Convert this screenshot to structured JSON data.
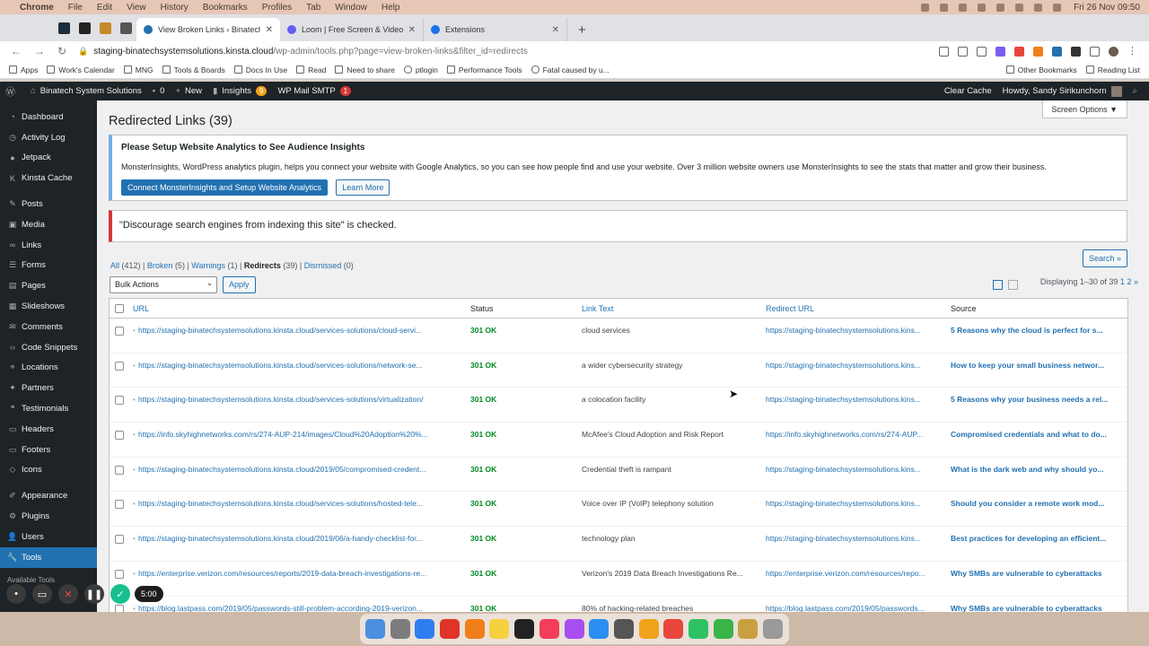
{
  "menubar": {
    "app": "Chrome",
    "items": [
      "File",
      "Edit",
      "View",
      "History",
      "Bookmarks",
      "Profiles",
      "Tab",
      "Window",
      "Help"
    ],
    "clock": "Fri 26 Nov  09:50"
  },
  "tabs": [
    {
      "title": "View Broken Links ‹ Binatech S",
      "active": true,
      "color": "#2271b1"
    },
    {
      "title": "Loom | Free Screen & Video Re",
      "active": false,
      "color": "#625df5"
    },
    {
      "title": "Extensions",
      "active": false,
      "color": "#1a73e8"
    }
  ],
  "toolbar": {
    "url_host": "staging-binatechsystemsolutions.kinsta.cloud",
    "url_path": "/wp-admin/tools.php?page=view-broken-links&filter_id=redirects"
  },
  "bookmarks": {
    "left": [
      "Apps",
      "Work's Calendar",
      "MNG",
      "Tools & Boards",
      "Docs In Use",
      "Read",
      "Need to share",
      "ptlogin",
      "Performance Tools",
      "Fatal caused by u..."
    ],
    "right": [
      "Other Bookmarks",
      "Reading List"
    ]
  },
  "adminbar": {
    "site": "Binatech System Solutions",
    "comments": "0",
    "new": "New",
    "insights": "Insights",
    "insights_badge": "9",
    "smtp": "WP Mail SMTP",
    "smtp_badge": "1",
    "clear_cache": "Clear Cache",
    "howdy": "Howdy, Sandy Sirikunchorn"
  },
  "sidebar": {
    "groups": [
      [
        {
          "label": "Dashboard",
          "icon": "dashboard-icon",
          "glyph": "◔"
        },
        {
          "label": "Activity Log",
          "icon": "activity-icon",
          "glyph": "◷"
        },
        {
          "label": "Jetpack",
          "icon": "jetpack-icon",
          "glyph": "●"
        },
        {
          "label": "Kinsta Cache",
          "icon": "kinsta-icon",
          "glyph": "K"
        }
      ],
      [
        {
          "label": "Posts",
          "icon": "posts-icon",
          "glyph": "✎"
        },
        {
          "label": "Media",
          "icon": "media-icon",
          "glyph": "▣"
        },
        {
          "label": "Links",
          "icon": "links-icon",
          "glyph": "∞"
        },
        {
          "label": "Forms",
          "icon": "forms-icon",
          "glyph": "☰"
        },
        {
          "label": "Pages",
          "icon": "pages-icon",
          "glyph": "▤"
        },
        {
          "label": "Slideshows",
          "icon": "slideshows-icon",
          "glyph": "▦"
        },
        {
          "label": "Comments",
          "icon": "comments-icon",
          "glyph": "✉"
        },
        {
          "label": "Code Snippets",
          "icon": "code-icon",
          "glyph": "‹›"
        },
        {
          "label": "Locations",
          "icon": "locations-icon",
          "glyph": "⌖"
        },
        {
          "label": "Partners",
          "icon": "partners-icon",
          "glyph": "✦"
        },
        {
          "label": "Testimonials",
          "icon": "testimonials-icon",
          "glyph": "❝"
        },
        {
          "label": "Headers",
          "icon": "headers-icon",
          "glyph": "▭"
        },
        {
          "label": "Footers",
          "icon": "footers-icon",
          "glyph": "▭"
        },
        {
          "label": "Icons",
          "icon": "icons-icon",
          "glyph": "◇"
        }
      ],
      [
        {
          "label": "Appearance",
          "icon": "appearance-icon",
          "glyph": "✐"
        },
        {
          "label": "Plugins",
          "icon": "plugins-icon",
          "glyph": "⚙"
        },
        {
          "label": "Users",
          "icon": "users-icon",
          "glyph": "👤"
        },
        {
          "label": "Tools",
          "icon": "tools-icon",
          "glyph": "🔧",
          "active": true
        }
      ]
    ],
    "sub": "Available Tools"
  },
  "main": {
    "screen_options": "Screen Options ▼",
    "title": "Redirected Links (39)",
    "notice_title": "Please Setup Website Analytics to See Audience Insights",
    "notice_text": "MonsterInsights, WordPress analytics plugin, helps you connect your website with Google Analytics, so you can see how people find and use your website. Over 3 million website owners use MonsterInsights to see the stats that matter and grow their business.",
    "notice_primary": "Connect MonsterInsights and Setup Website Analytics",
    "notice_secondary": "Learn More",
    "error": "\"Discourage search engines from indexing this site\" is checked.",
    "filters": {
      "all": "All",
      "all_count": "(412)",
      "broken": "Broken",
      "broken_count": "(5)",
      "warnings": "Warnings",
      "warnings_count": "(1)",
      "redirects": "Redirects",
      "redirects_count": "(39)",
      "dismissed": "Dismissed",
      "dismissed_count": "(0)"
    },
    "search": "Search »",
    "bulk": "Bulk Actions",
    "apply": "Apply",
    "paging": "Displaying 1–30 of 39",
    "page1": "1",
    "page2": "2",
    "next": "»",
    "columns": {
      "url": "URL",
      "status": "Status",
      "text": "Link Text",
      "redirect": "Redirect URL",
      "source": "Source"
    },
    "rows": [
      {
        "url": "https://staging-binatechsystemsolutions.kinsta.cloud/services-solutions/cloud-servi...",
        "status": "301 OK",
        "text": "cloud services",
        "redirect": "https://staging-binatechsystemsolutions.kins...",
        "source": "5 Reasons why the cloud is perfect for s..."
      },
      {
        "url": "https://staging-binatechsystemsolutions.kinsta.cloud/services-solutions/network-se...",
        "status": "301 OK",
        "text": "a wider cybersecurity strategy",
        "redirect": "https://staging-binatechsystemsolutions.kins...",
        "source": "How to keep your small business networ..."
      },
      {
        "url": "https://staging-binatechsystemsolutions.kinsta.cloud/services-solutions/virtualization/",
        "status": "301 OK",
        "text": "a colocation facility",
        "redirect": "https://staging-binatechsystemsolutions.kins...",
        "source": "5 Reasons why your business needs a rel..."
      },
      {
        "url": "https://info.skyhighnetworks.com/rs/274-AUP-214/images/Cloud%20Adoption%20%...",
        "status": "301 OK",
        "text": "McAfee's Cloud Adoption and Risk Report",
        "redirect": "https://info.skyhighnetworks.com/rs/274-AUP...",
        "source": "Compromised credentials and what to do..."
      },
      {
        "url": "https://staging-binatechsystemsolutions.kinsta.cloud/2019/05/compromised-credent...",
        "status": "301 OK",
        "text": "Credential theft is rampant",
        "redirect": "https://staging-binatechsystemsolutions.kins...",
        "source": "What is the dark web and why should yo..."
      },
      {
        "url": "https://staging-binatechsystemsolutions.kinsta.cloud/services-solutions/hosted-tele...",
        "status": "301 OK",
        "text": "Voice over IP (VoIP) telephony solution",
        "redirect": "https://staging-binatechsystemsolutions.kins...",
        "source": "Should you consider a remote work mod..."
      },
      {
        "url": "https://staging-binatechsystemsolutions.kinsta.cloud/2019/06/a-handy-checklist-for...",
        "status": "301 OK",
        "text": "technology plan",
        "redirect": "https://staging-binatechsystemsolutions.kins...",
        "source": "Best practices for developing an efficient..."
      },
      {
        "url": "https://enterprise.verizon.com/resources/reports/2019-data-breach-investigations-re...",
        "status": "301 OK",
        "text": "Verizon's 2019 Data Breach Investigations Re...",
        "redirect": "https://enterprise.verizon.com/resources/repo...",
        "source": "Why SMBs are vulnerable to cyberattacks"
      },
      {
        "url": "https://blog.lastpass.com/2019/05/passwords-still-problem-according-2019-verizon...",
        "status": "301 OK",
        "text": "80% of hacking-related breaches",
        "redirect": "https://blog.lastpass.com/2019/05/passwords...",
        "source": "Why SMBs are vulnerable to cyberattacks"
      }
    ]
  },
  "recorder": {
    "time": "5:00"
  },
  "dock_colors": [
    "#4a8fe0",
    "#7c7c7c",
    "#2f7ef0",
    "#e0342a",
    "#f07e1a",
    "#f5d142",
    "#222222",
    "#f23e5a",
    "#a74ef0",
    "#2b8ef0",
    "#555555",
    "#f0a21a",
    "#e8453c",
    "#2ec264",
    "#39b54a",
    "#c9a040",
    "#9a9a9a"
  ]
}
